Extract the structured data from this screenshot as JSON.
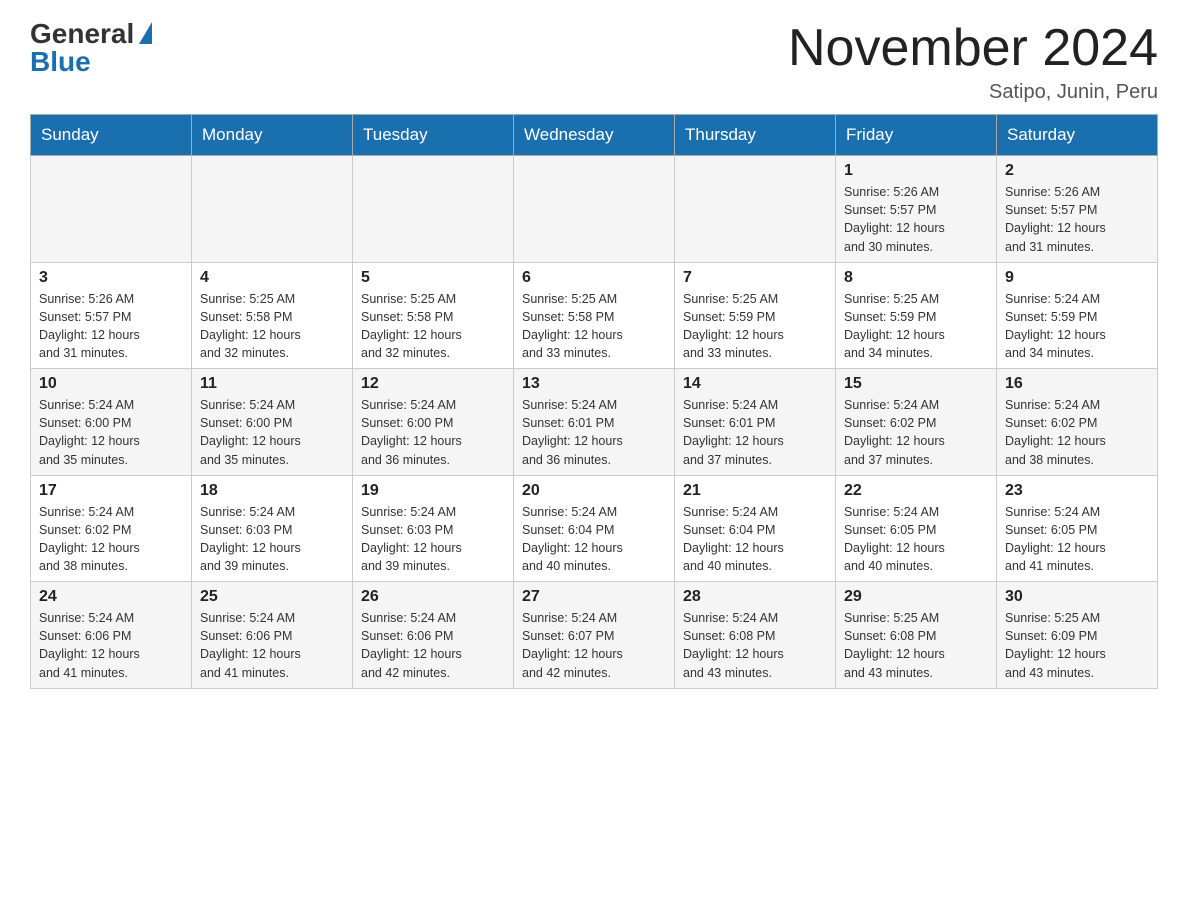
{
  "header": {
    "logo_general": "General",
    "logo_blue": "Blue",
    "title": "November 2024",
    "location": "Satipo, Junin, Peru"
  },
  "days_of_week": [
    "Sunday",
    "Monday",
    "Tuesday",
    "Wednesday",
    "Thursday",
    "Friday",
    "Saturday"
  ],
  "weeks": [
    [
      {
        "day": "",
        "info": ""
      },
      {
        "day": "",
        "info": ""
      },
      {
        "day": "",
        "info": ""
      },
      {
        "day": "",
        "info": ""
      },
      {
        "day": "",
        "info": ""
      },
      {
        "day": "1",
        "info": "Sunrise: 5:26 AM\nSunset: 5:57 PM\nDaylight: 12 hours\nand 30 minutes."
      },
      {
        "day": "2",
        "info": "Sunrise: 5:26 AM\nSunset: 5:57 PM\nDaylight: 12 hours\nand 31 minutes."
      }
    ],
    [
      {
        "day": "3",
        "info": "Sunrise: 5:26 AM\nSunset: 5:57 PM\nDaylight: 12 hours\nand 31 minutes."
      },
      {
        "day": "4",
        "info": "Sunrise: 5:25 AM\nSunset: 5:58 PM\nDaylight: 12 hours\nand 32 minutes."
      },
      {
        "day": "5",
        "info": "Sunrise: 5:25 AM\nSunset: 5:58 PM\nDaylight: 12 hours\nand 32 minutes."
      },
      {
        "day": "6",
        "info": "Sunrise: 5:25 AM\nSunset: 5:58 PM\nDaylight: 12 hours\nand 33 minutes."
      },
      {
        "day": "7",
        "info": "Sunrise: 5:25 AM\nSunset: 5:59 PM\nDaylight: 12 hours\nand 33 minutes."
      },
      {
        "day": "8",
        "info": "Sunrise: 5:25 AM\nSunset: 5:59 PM\nDaylight: 12 hours\nand 34 minutes."
      },
      {
        "day": "9",
        "info": "Sunrise: 5:24 AM\nSunset: 5:59 PM\nDaylight: 12 hours\nand 34 minutes."
      }
    ],
    [
      {
        "day": "10",
        "info": "Sunrise: 5:24 AM\nSunset: 6:00 PM\nDaylight: 12 hours\nand 35 minutes."
      },
      {
        "day": "11",
        "info": "Sunrise: 5:24 AM\nSunset: 6:00 PM\nDaylight: 12 hours\nand 35 minutes."
      },
      {
        "day": "12",
        "info": "Sunrise: 5:24 AM\nSunset: 6:00 PM\nDaylight: 12 hours\nand 36 minutes."
      },
      {
        "day": "13",
        "info": "Sunrise: 5:24 AM\nSunset: 6:01 PM\nDaylight: 12 hours\nand 36 minutes."
      },
      {
        "day": "14",
        "info": "Sunrise: 5:24 AM\nSunset: 6:01 PM\nDaylight: 12 hours\nand 37 minutes."
      },
      {
        "day": "15",
        "info": "Sunrise: 5:24 AM\nSunset: 6:02 PM\nDaylight: 12 hours\nand 37 minutes."
      },
      {
        "day": "16",
        "info": "Sunrise: 5:24 AM\nSunset: 6:02 PM\nDaylight: 12 hours\nand 38 minutes."
      }
    ],
    [
      {
        "day": "17",
        "info": "Sunrise: 5:24 AM\nSunset: 6:02 PM\nDaylight: 12 hours\nand 38 minutes."
      },
      {
        "day": "18",
        "info": "Sunrise: 5:24 AM\nSunset: 6:03 PM\nDaylight: 12 hours\nand 39 minutes."
      },
      {
        "day": "19",
        "info": "Sunrise: 5:24 AM\nSunset: 6:03 PM\nDaylight: 12 hours\nand 39 minutes."
      },
      {
        "day": "20",
        "info": "Sunrise: 5:24 AM\nSunset: 6:04 PM\nDaylight: 12 hours\nand 40 minutes."
      },
      {
        "day": "21",
        "info": "Sunrise: 5:24 AM\nSunset: 6:04 PM\nDaylight: 12 hours\nand 40 minutes."
      },
      {
        "day": "22",
        "info": "Sunrise: 5:24 AM\nSunset: 6:05 PM\nDaylight: 12 hours\nand 40 minutes."
      },
      {
        "day": "23",
        "info": "Sunrise: 5:24 AM\nSunset: 6:05 PM\nDaylight: 12 hours\nand 41 minutes."
      }
    ],
    [
      {
        "day": "24",
        "info": "Sunrise: 5:24 AM\nSunset: 6:06 PM\nDaylight: 12 hours\nand 41 minutes."
      },
      {
        "day": "25",
        "info": "Sunrise: 5:24 AM\nSunset: 6:06 PM\nDaylight: 12 hours\nand 41 minutes."
      },
      {
        "day": "26",
        "info": "Sunrise: 5:24 AM\nSunset: 6:06 PM\nDaylight: 12 hours\nand 42 minutes."
      },
      {
        "day": "27",
        "info": "Sunrise: 5:24 AM\nSunset: 6:07 PM\nDaylight: 12 hours\nand 42 minutes."
      },
      {
        "day": "28",
        "info": "Sunrise: 5:24 AM\nSunset: 6:08 PM\nDaylight: 12 hours\nand 43 minutes."
      },
      {
        "day": "29",
        "info": "Sunrise: 5:25 AM\nSunset: 6:08 PM\nDaylight: 12 hours\nand 43 minutes."
      },
      {
        "day": "30",
        "info": "Sunrise: 5:25 AM\nSunset: 6:09 PM\nDaylight: 12 hours\nand 43 minutes."
      }
    ]
  ]
}
